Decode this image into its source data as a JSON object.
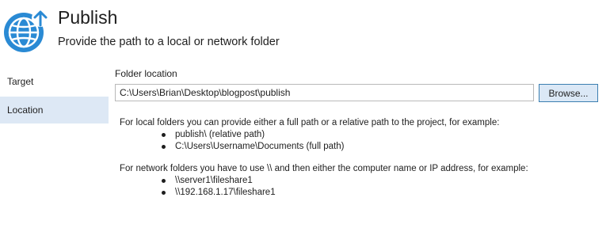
{
  "header": {
    "title": "Publish",
    "subtitle": "Provide the path to a local or network folder",
    "icon": "globe-upload-icon",
    "accent_color": "#2a8ad4"
  },
  "sidebar": {
    "items": [
      {
        "label": "Target",
        "selected": false
      },
      {
        "label": "Location",
        "selected": true
      }
    ],
    "selected_color": "#dde8f5"
  },
  "main": {
    "folder_label": "Folder location",
    "folder_value": "C:\\Users\\Brian\\Desktop\\blogpost\\publish",
    "browse_label": "Browse...",
    "local_help": {
      "text": "For local folders you can provide either a full path or a relative path to the project, for example:",
      "examples": [
        "publish\\ (relative path)",
        "C:\\Users\\Username\\Documents (full path)"
      ]
    },
    "network_help": {
      "text": "For network folders you have to use \\\\ and then either the computer name or IP address, for example:",
      "examples": [
        "\\\\server1\\fileshare1",
        "\\\\192.168.1.17\\fileshare1"
      ]
    }
  }
}
